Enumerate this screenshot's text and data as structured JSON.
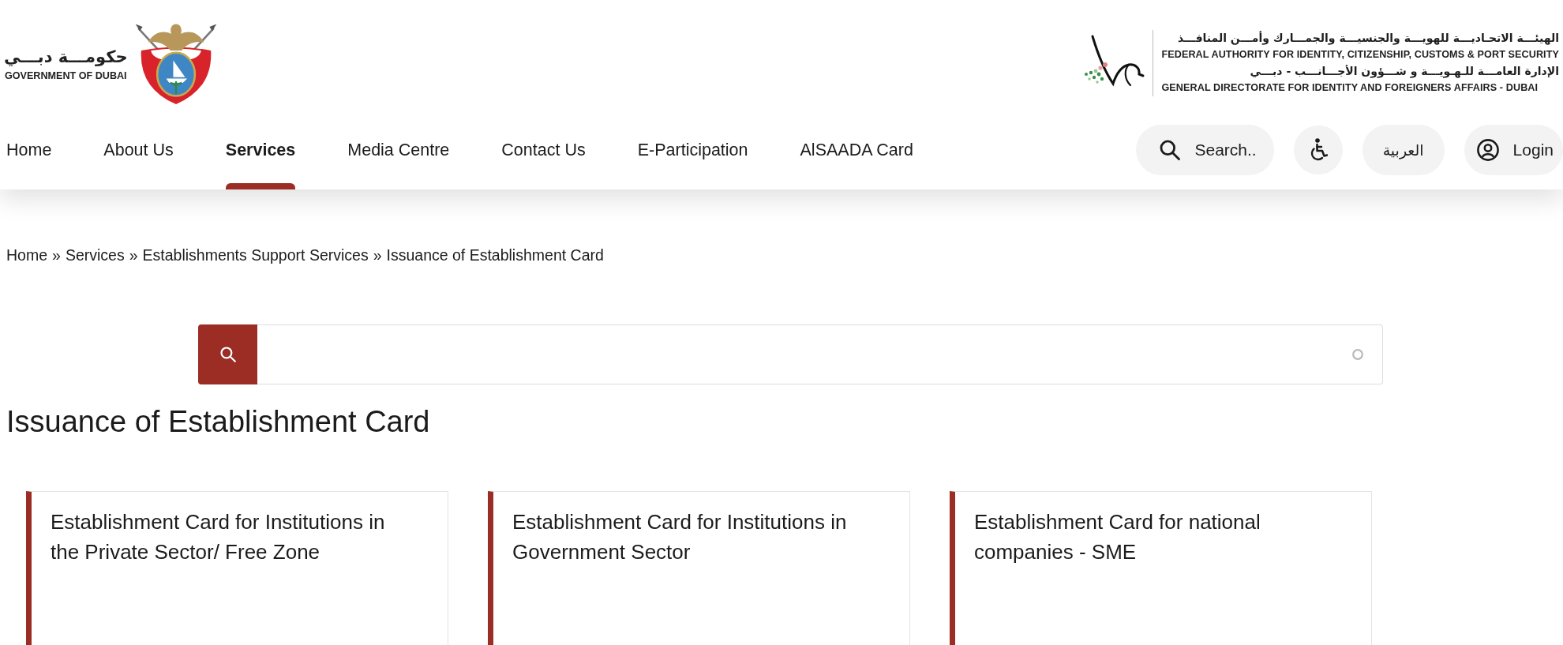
{
  "header": {
    "government_logo": {
      "arabic": "حكومـــة دبـــي",
      "english": "GOVERNMENT OF DUBAI"
    },
    "authority_logo": {
      "lines": [
        {
          "kind": "arabic",
          "text": "الهيئـــة الاتحـاديـــة للهويـــة والجنسيـــة والجمـــارك وأمـــن المنافـــذ"
        },
        {
          "kind": "english",
          "text": "FEDERAL AUTHORITY FOR IDENTITY, CITIZENSHIP, CUSTOMS & PORT SECURITY"
        },
        {
          "kind": "arabic",
          "text": "الإدارة العامـــة للـهـويـــة و شـــؤون الأجـــانـــب - دبـــي"
        },
        {
          "kind": "english",
          "text": "GENERAL DIRECTORATE FOR IDENTITY AND FOREIGNERS AFFAIRS - DUBAI"
        }
      ]
    }
  },
  "nav": {
    "items": [
      {
        "label": "Home",
        "selected": false
      },
      {
        "label": "About Us",
        "selected": false
      },
      {
        "label": "Services",
        "selected": true
      },
      {
        "label": "Media Centre",
        "selected": false
      },
      {
        "label": "Contact Us",
        "selected": false
      },
      {
        "label": "E-Participation",
        "selected": false
      },
      {
        "label": "AlSAADA Card",
        "selected": false
      }
    ],
    "search": "Search..",
    "language": "العربية",
    "login": "Login"
  },
  "breadcrumb": {
    "items": [
      "Home",
      "Services",
      "Establishments Support Services",
      "Issuance of Establishment Card"
    ],
    "separators": [
      "»",
      "»",
      "»"
    ]
  },
  "page_title": "Issuance of Establishment Card",
  "cards": [
    {
      "title": "Establishment Card for Institutions in the Private Sector/ Free Zone"
    },
    {
      "title": "Establishment Card for Institutions in Government Sector"
    },
    {
      "title": "Establishment Card for national companies - SME"
    }
  ]
}
